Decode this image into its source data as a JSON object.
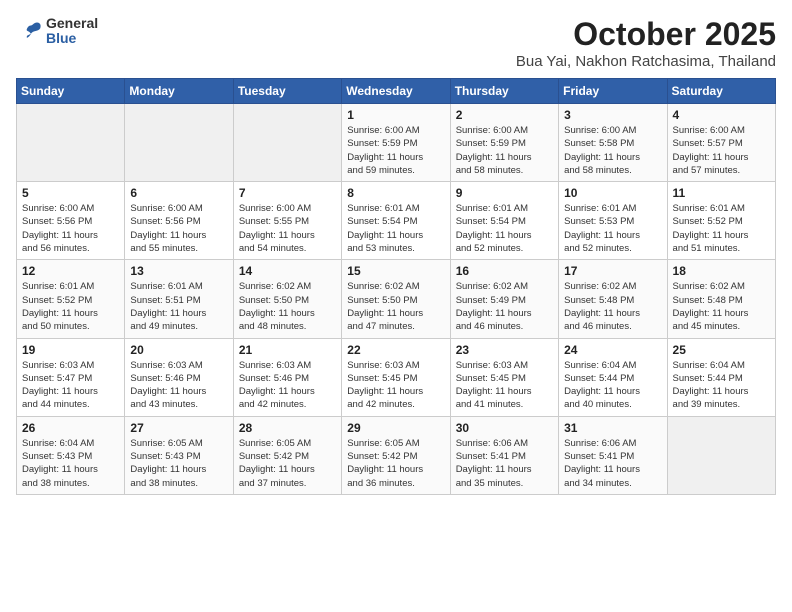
{
  "header": {
    "logo_general": "General",
    "logo_blue": "Blue",
    "title": "October 2025",
    "subtitle": "Bua Yai, Nakhon Ratchasima, Thailand"
  },
  "days_of_week": [
    "Sunday",
    "Monday",
    "Tuesday",
    "Wednesday",
    "Thursday",
    "Friday",
    "Saturday"
  ],
  "weeks": [
    [
      {
        "day": "",
        "info": ""
      },
      {
        "day": "",
        "info": ""
      },
      {
        "day": "",
        "info": ""
      },
      {
        "day": "1",
        "info": "Sunrise: 6:00 AM\nSunset: 5:59 PM\nDaylight: 11 hours\nand 59 minutes."
      },
      {
        "day": "2",
        "info": "Sunrise: 6:00 AM\nSunset: 5:59 PM\nDaylight: 11 hours\nand 58 minutes."
      },
      {
        "day": "3",
        "info": "Sunrise: 6:00 AM\nSunset: 5:58 PM\nDaylight: 11 hours\nand 58 minutes."
      },
      {
        "day": "4",
        "info": "Sunrise: 6:00 AM\nSunset: 5:57 PM\nDaylight: 11 hours\nand 57 minutes."
      }
    ],
    [
      {
        "day": "5",
        "info": "Sunrise: 6:00 AM\nSunset: 5:56 PM\nDaylight: 11 hours\nand 56 minutes."
      },
      {
        "day": "6",
        "info": "Sunrise: 6:00 AM\nSunset: 5:56 PM\nDaylight: 11 hours\nand 55 minutes."
      },
      {
        "day": "7",
        "info": "Sunrise: 6:00 AM\nSunset: 5:55 PM\nDaylight: 11 hours\nand 54 minutes."
      },
      {
        "day": "8",
        "info": "Sunrise: 6:01 AM\nSunset: 5:54 PM\nDaylight: 11 hours\nand 53 minutes."
      },
      {
        "day": "9",
        "info": "Sunrise: 6:01 AM\nSunset: 5:54 PM\nDaylight: 11 hours\nand 52 minutes."
      },
      {
        "day": "10",
        "info": "Sunrise: 6:01 AM\nSunset: 5:53 PM\nDaylight: 11 hours\nand 52 minutes."
      },
      {
        "day": "11",
        "info": "Sunrise: 6:01 AM\nSunset: 5:52 PM\nDaylight: 11 hours\nand 51 minutes."
      }
    ],
    [
      {
        "day": "12",
        "info": "Sunrise: 6:01 AM\nSunset: 5:52 PM\nDaylight: 11 hours\nand 50 minutes."
      },
      {
        "day": "13",
        "info": "Sunrise: 6:01 AM\nSunset: 5:51 PM\nDaylight: 11 hours\nand 49 minutes."
      },
      {
        "day": "14",
        "info": "Sunrise: 6:02 AM\nSunset: 5:50 PM\nDaylight: 11 hours\nand 48 minutes."
      },
      {
        "day": "15",
        "info": "Sunrise: 6:02 AM\nSunset: 5:50 PM\nDaylight: 11 hours\nand 47 minutes."
      },
      {
        "day": "16",
        "info": "Sunrise: 6:02 AM\nSunset: 5:49 PM\nDaylight: 11 hours\nand 46 minutes."
      },
      {
        "day": "17",
        "info": "Sunrise: 6:02 AM\nSunset: 5:48 PM\nDaylight: 11 hours\nand 46 minutes."
      },
      {
        "day": "18",
        "info": "Sunrise: 6:02 AM\nSunset: 5:48 PM\nDaylight: 11 hours\nand 45 minutes."
      }
    ],
    [
      {
        "day": "19",
        "info": "Sunrise: 6:03 AM\nSunset: 5:47 PM\nDaylight: 11 hours\nand 44 minutes."
      },
      {
        "day": "20",
        "info": "Sunrise: 6:03 AM\nSunset: 5:46 PM\nDaylight: 11 hours\nand 43 minutes."
      },
      {
        "day": "21",
        "info": "Sunrise: 6:03 AM\nSunset: 5:46 PM\nDaylight: 11 hours\nand 42 minutes."
      },
      {
        "day": "22",
        "info": "Sunrise: 6:03 AM\nSunset: 5:45 PM\nDaylight: 11 hours\nand 42 minutes."
      },
      {
        "day": "23",
        "info": "Sunrise: 6:03 AM\nSunset: 5:45 PM\nDaylight: 11 hours\nand 41 minutes."
      },
      {
        "day": "24",
        "info": "Sunrise: 6:04 AM\nSunset: 5:44 PM\nDaylight: 11 hours\nand 40 minutes."
      },
      {
        "day": "25",
        "info": "Sunrise: 6:04 AM\nSunset: 5:44 PM\nDaylight: 11 hours\nand 39 minutes."
      }
    ],
    [
      {
        "day": "26",
        "info": "Sunrise: 6:04 AM\nSunset: 5:43 PM\nDaylight: 11 hours\nand 38 minutes."
      },
      {
        "day": "27",
        "info": "Sunrise: 6:05 AM\nSunset: 5:43 PM\nDaylight: 11 hours\nand 38 minutes."
      },
      {
        "day": "28",
        "info": "Sunrise: 6:05 AM\nSunset: 5:42 PM\nDaylight: 11 hours\nand 37 minutes."
      },
      {
        "day": "29",
        "info": "Sunrise: 6:05 AM\nSunset: 5:42 PM\nDaylight: 11 hours\nand 36 minutes."
      },
      {
        "day": "30",
        "info": "Sunrise: 6:06 AM\nSunset: 5:41 PM\nDaylight: 11 hours\nand 35 minutes."
      },
      {
        "day": "31",
        "info": "Sunrise: 6:06 AM\nSunset: 5:41 PM\nDaylight: 11 hours\nand 34 minutes."
      },
      {
        "day": "",
        "info": ""
      }
    ]
  ]
}
